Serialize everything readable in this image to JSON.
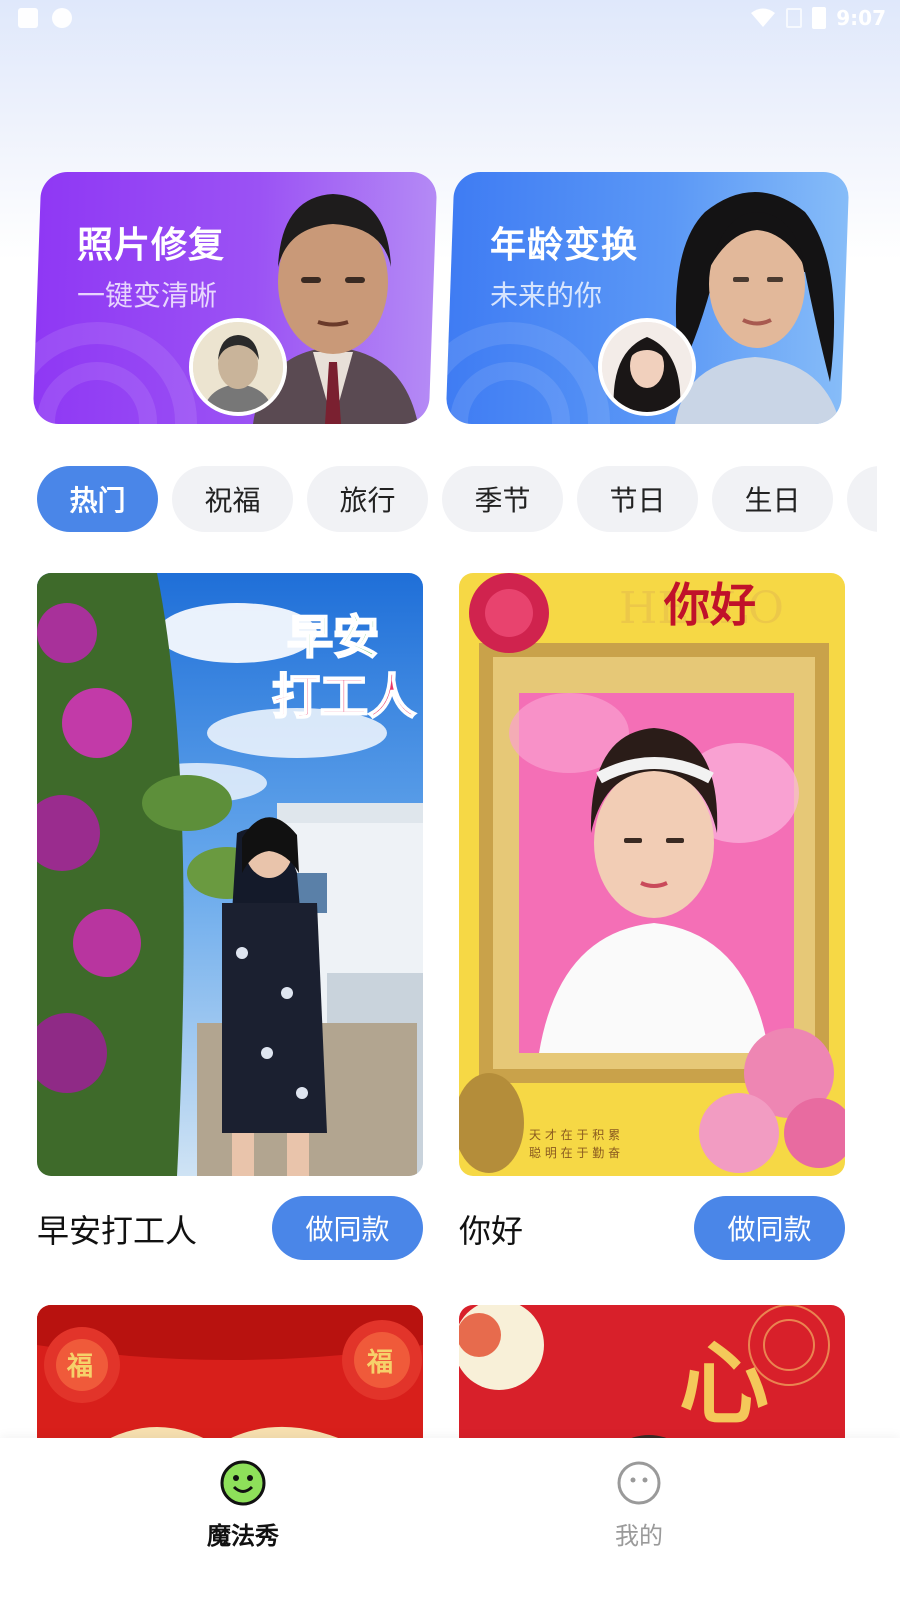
{
  "status_bar": {
    "time": "9:07"
  },
  "features": [
    {
      "title": "照片修复",
      "subtitle": "一键变清晰"
    },
    {
      "title": "年龄变换",
      "subtitle": "未来的你"
    }
  ],
  "tabs": [
    "热门",
    "祝福",
    "旅行",
    "季节",
    "节日",
    "生日"
  ],
  "cards": [
    {
      "title": "早安打工人",
      "button": "做同款",
      "overlay_text": "早安打工人"
    },
    {
      "title": "你好",
      "button": "做同款",
      "overlay_text": "你好",
      "overlay_sub": "HELLO"
    },
    {
      "overlay_text": "福"
    },
    {
      "overlay_text": "心"
    }
  ],
  "bottom_nav": [
    {
      "label": "魔法秀",
      "icon": "smile-face-icon"
    },
    {
      "label": "我的",
      "icon": "profile-face-icon"
    }
  ],
  "colors": {
    "accent": "#4a86e8",
    "card1": "#9b52f4",
    "card2": "#5b98f6"
  }
}
